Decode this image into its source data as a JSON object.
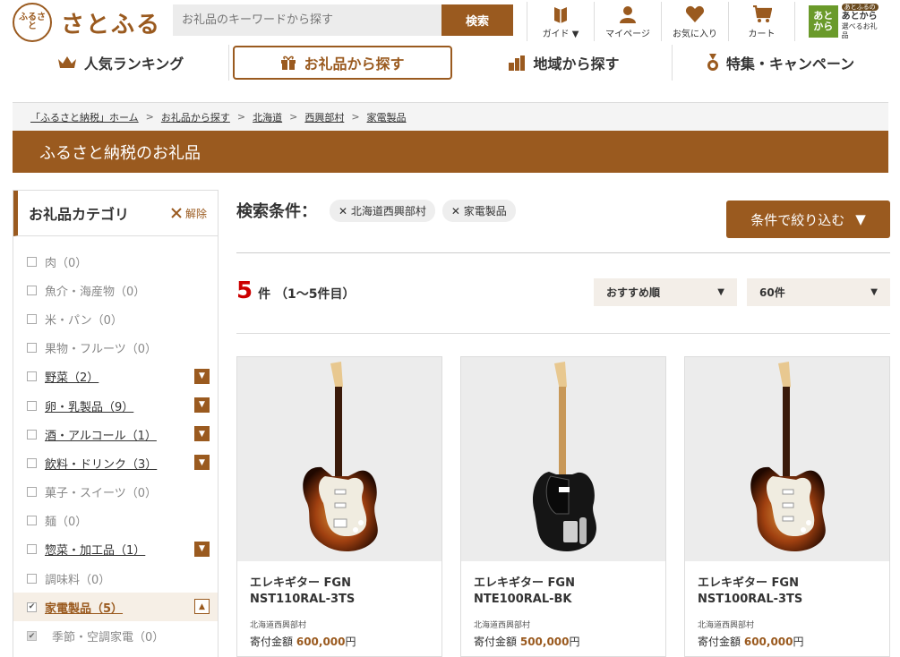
{
  "header": {
    "logo_seal": "ふるさと",
    "logo_text": "さとふる",
    "search_placeholder": "お礼品のキーワードから探す",
    "search_button": "検索",
    "icons": [
      {
        "name": "guide",
        "label": "ガイド ▼"
      },
      {
        "name": "mypage",
        "label": "マイページ"
      },
      {
        "name": "favorites",
        "label": "お気に入り"
      },
      {
        "name": "cart",
        "label": "カート"
      }
    ],
    "atokara": {
      "box": "あと から",
      "pill": "あとふるの",
      "line1": "あとから",
      "line2": "選べるお礼品"
    }
  },
  "nav": [
    {
      "label": "人気ランキング"
    },
    {
      "label": "お礼品から探す"
    },
    {
      "label": "地域から探す"
    },
    {
      "label": "特集・キャンペーン"
    }
  ],
  "breadcrumb": [
    "「ふるさと納税」ホーム",
    "お礼品から探す",
    "北海道",
    "西興部村",
    "家電製品"
  ],
  "banner_title": "ふるさと納税のお礼品",
  "sidebar": {
    "title": "お礼品カテゴリ",
    "clear_label": "解除",
    "categories": [
      {
        "label": "肉（0）"
      },
      {
        "label": "魚介・海産物（0）"
      },
      {
        "label": "米・パン（0）"
      },
      {
        "label": "果物・フルーツ（0）"
      },
      {
        "label": "野菜（2）"
      },
      {
        "label": "卵・乳製品（9）"
      },
      {
        "label": "酒・アルコール（1）"
      },
      {
        "label": "飲料・ドリンク（3）"
      },
      {
        "label": "菓子・スイーツ（0）"
      },
      {
        "label": "麺（0）"
      },
      {
        "label": "惣菜・加工品（1）"
      },
      {
        "label": "調味料（0）"
      },
      {
        "label": "家電製品（5）"
      },
      {
        "label": "季節・空調家電（0）"
      }
    ]
  },
  "search_conditions": {
    "title": "検索条件：",
    "chips": [
      "北海道西興部村",
      "家電製品"
    ],
    "refine_button": "条件で絞り込む"
  },
  "results": {
    "count": "5",
    "count_text": "件 （1～5件目）",
    "sort_selected": "おすすめ順",
    "per_page_selected": "60件"
  },
  "products": [
    {
      "title": "エレキギター FGN NST110RAL-3TS",
      "region": "北海道西興部村",
      "price_label": "寄付金額",
      "price": "600,000",
      "unit": "円"
    },
    {
      "title": "エレキギター FGN NTE100RAL-BK",
      "region": "北海道西興部村",
      "price_label": "寄付金額",
      "price": "500,000",
      "unit": "円"
    },
    {
      "title": "エレキギター FGN NST100RAL-3TS",
      "region": "北海道西興部村",
      "price_label": "寄付金額",
      "price": "600,000",
      "unit": "円"
    }
  ],
  "colors": {
    "brand": "#9a5a1f",
    "count_red": "#cc0000"
  }
}
